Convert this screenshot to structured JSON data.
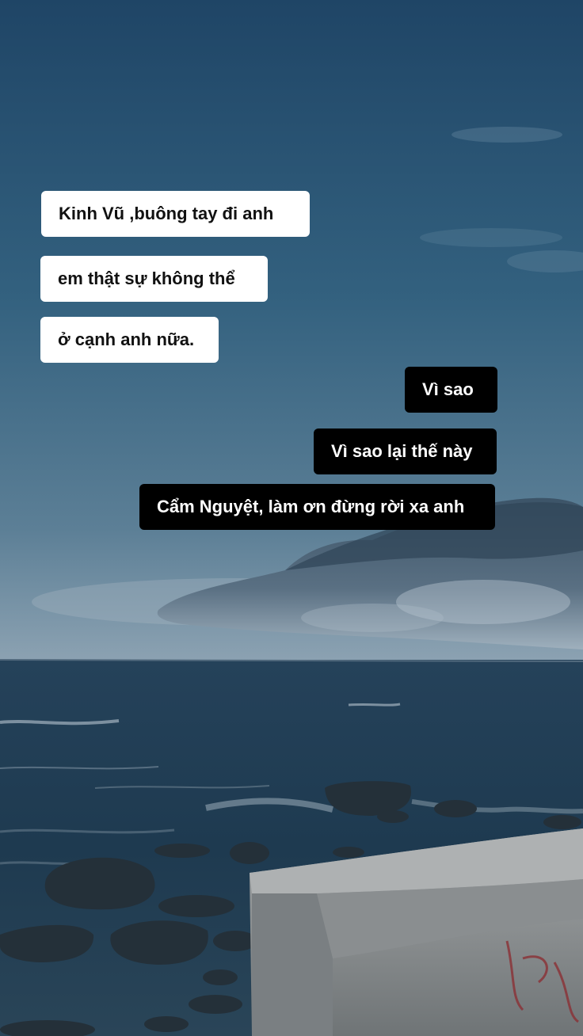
{
  "messages": [
    {
      "text": "Kinh Vũ ,buông tay đi anh",
      "side": "left"
    },
    {
      "text": "em thật sự không thể",
      "side": "left"
    },
    {
      "text": "ở cạnh anh nữa.",
      "side": "left"
    },
    {
      "text": "Vì sao",
      "side": "right"
    },
    {
      "text": "Vì sao lại thế này",
      "side": "right"
    },
    {
      "text": "Cẩm Nguyệt, làm ơn đừng rời xa anh",
      "side": "right"
    }
  ],
  "background": {
    "sky_top": "#1f4566",
    "sky_horizon": "#7b93a5",
    "sea": "#1f3a4e",
    "foam": "#c7d3dc",
    "concrete": "#8f9396",
    "graffiti": "#8b2f34"
  }
}
